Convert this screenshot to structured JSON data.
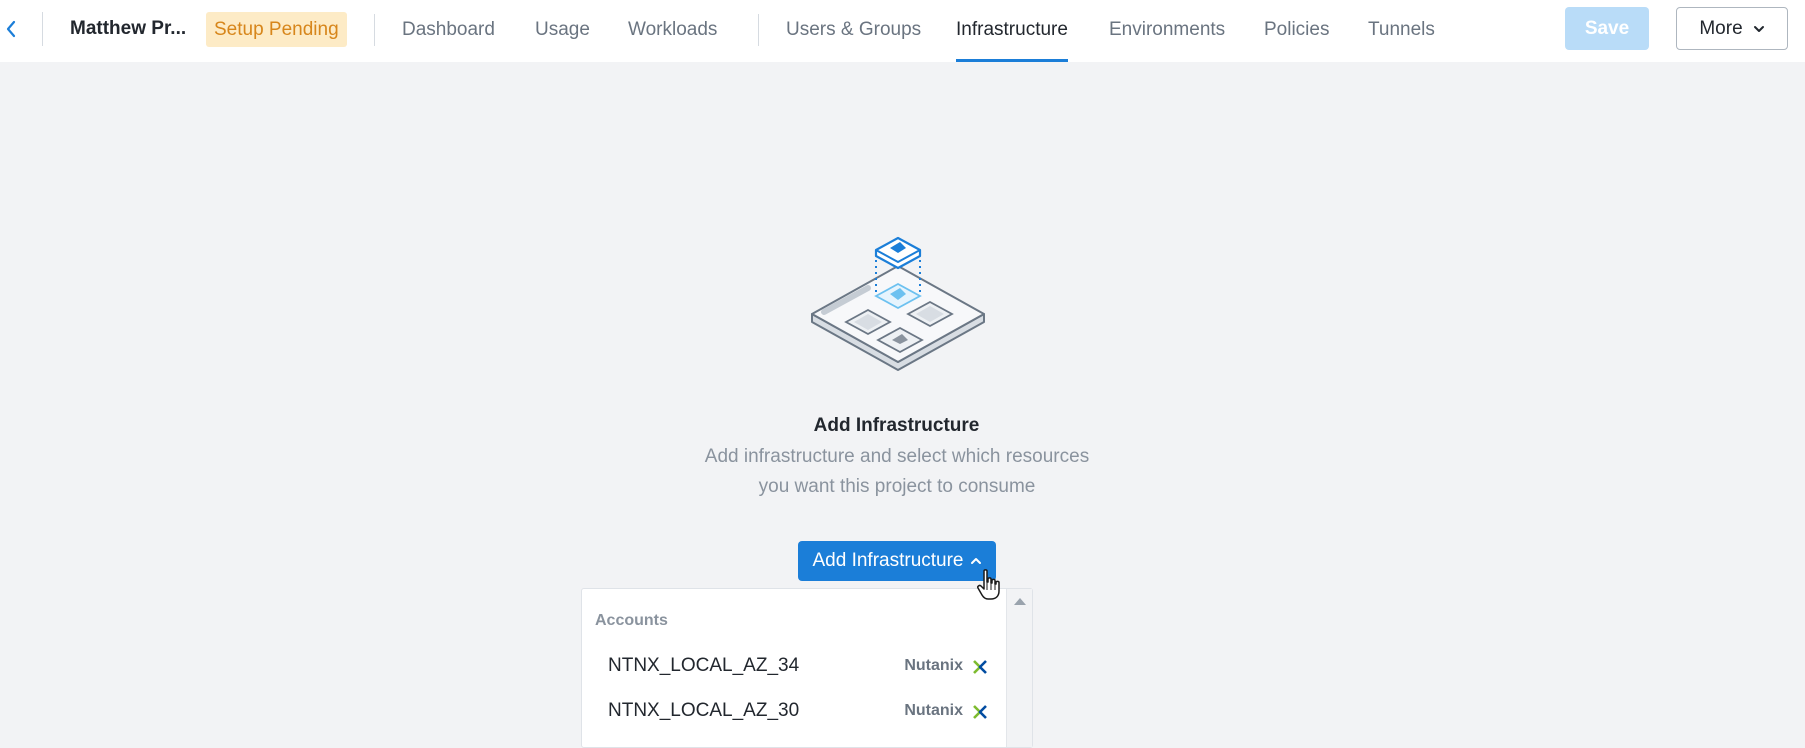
{
  "header": {
    "project_name": "Matthew Pr...",
    "status_badge": "Setup Pending",
    "tabs": [
      {
        "label": "Dashboard"
      },
      {
        "label": "Usage"
      },
      {
        "label": "Workloads"
      },
      {
        "label": "Users & Groups"
      },
      {
        "label": "Infrastructure"
      },
      {
        "label": "Environments"
      },
      {
        "label": "Policies"
      },
      {
        "label": "Tunnels"
      }
    ],
    "active_tab": "Infrastructure",
    "save_label": "Save",
    "more_label": "More"
  },
  "empty_state": {
    "title": "Add Infrastructure",
    "description": "Add infrastructure and select which resources you want this project to consume",
    "button_label": "Add Infrastructure"
  },
  "dropdown": {
    "section_header": "Accounts",
    "items": [
      {
        "name": "NTNX_LOCAL_AZ_34",
        "provider": "Nutanix",
        "icon": "nutanix-logo-icon"
      },
      {
        "name": "NTNX_LOCAL_AZ_30",
        "provider": "Nutanix",
        "icon": "nutanix-logo-icon"
      }
    ]
  },
  "colors": {
    "accent": "#1b7ed8",
    "save_disabled": "#b9dcf8",
    "badge_bg": "#fdebc6",
    "badge_text": "#d7861b",
    "page_bg": "#f2f3f5"
  }
}
